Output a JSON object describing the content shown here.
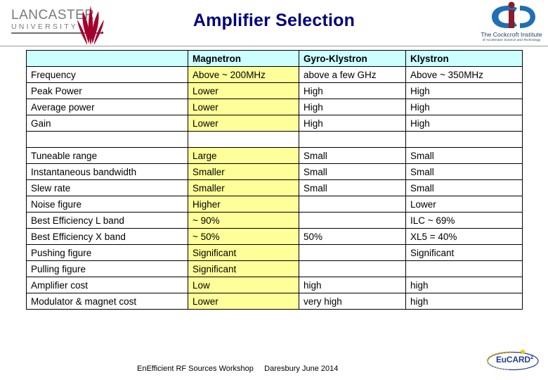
{
  "slide": {
    "title": "Amplifier Selection"
  },
  "logos": {
    "lancaster": {
      "name": "LANCASTER",
      "subtitle": "UNIVERSITY",
      "icon": "lancaster-rose-icon",
      "color": "#a3002e"
    },
    "cockcroft": {
      "name": "The Cockcroft Institute",
      "tagline": "of Accelerator Science and Technology",
      "icon": "cockcroft-ci-monogram-icon",
      "color": "#1f6fb5"
    },
    "eucard": {
      "name": "EuCARD",
      "superscript": "2",
      "icon": "eucard-ellipse-icon",
      "color": "#1f3f8f"
    }
  },
  "table": {
    "columns": [
      "",
      "Magnetron",
      "Gyro-Klystron",
      "Klystron"
    ],
    "accent_column_index": 1,
    "header_background": "#ccffff",
    "accent_background": "#ffff99",
    "accent_text_color": "#00008b",
    "rows": [
      {
        "label": "Frequency",
        "magnetron": "Above ~ 200MHz",
        "gyro_klystron": "above a few GHz",
        "klystron": "Above ~ 350MHz"
      },
      {
        "label": "Peak Power",
        "magnetron": "Lower",
        "gyro_klystron": "High",
        "klystron": "High"
      },
      {
        "label": "Average power",
        "magnetron": "Lower",
        "gyro_klystron": "High",
        "klystron": "High"
      },
      {
        "label": "Gain",
        "magnetron": "Lower",
        "gyro_klystron": "High",
        "klystron": "High"
      },
      {
        "label": "Tuneable range",
        "magnetron": "Large",
        "gyro_klystron": "Small",
        "klystron": "Small"
      },
      {
        "label": "Instantaneous bandwidth",
        "magnetron": "Smaller",
        "gyro_klystron": "Small",
        "klystron": "Small"
      },
      {
        "label": "Slew rate",
        "magnetron": "Smaller",
        "gyro_klystron": "Small",
        "klystron": "Small"
      },
      {
        "label": "Noise figure",
        "magnetron": "Higher",
        "gyro_klystron": "",
        "klystron": "Lower"
      },
      {
        "label": "Best Efficiency L band",
        "magnetron": "~ 90%",
        "gyro_klystron": "",
        "klystron": "ILC ~ 69%"
      },
      {
        "label": "Best Efficiency X band",
        "magnetron": "~ 50%",
        "gyro_klystron": "50%",
        "klystron": "XL5 = 40%"
      },
      {
        "label": "Pushing figure",
        "magnetron": "Significant",
        "gyro_klystron": "",
        "klystron": "Significant"
      },
      {
        "label": "Pulling figure",
        "magnetron": "Significant",
        "gyro_klystron": "",
        "klystron": ""
      },
      {
        "label": "Amplifier cost",
        "magnetron": "Low",
        "gyro_klystron": "high",
        "klystron": "high"
      },
      {
        "label": "Modulator & magnet cost",
        "magnetron": "Lower",
        "gyro_klystron": "very high",
        "klystron": "high"
      }
    ],
    "spacer_after_row_index": 3
  },
  "footer": {
    "text": "EnEfficient RF Sources Workshop     Daresbury June 2014"
  }
}
